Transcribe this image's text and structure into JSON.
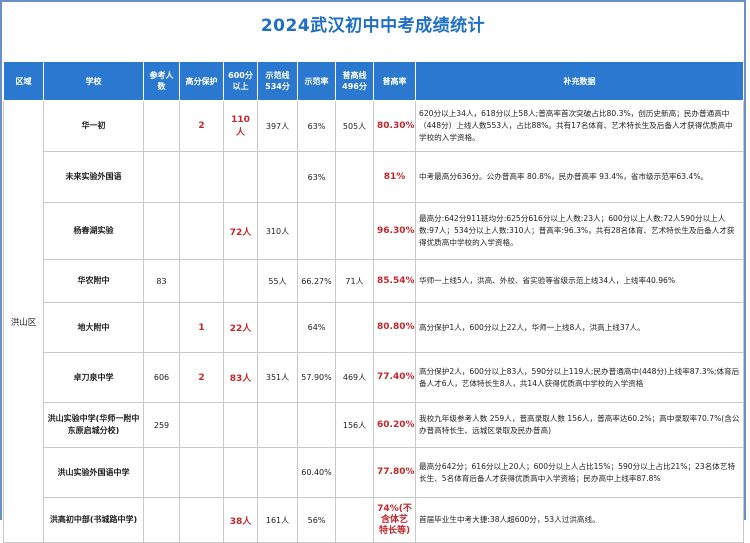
{
  "title": "2024武汉初中中考成绩统计",
  "columns": [
    "区域",
    "学校",
    "参考人数",
    "高分保护",
    "600分以上",
    "示范线534分",
    "示范率",
    "普高线496分",
    "普高率",
    "补充数据"
  ],
  "district": "洪山区",
  "rows": [
    {
      "school": "华一初",
      "ref": "",
      "hp": "2",
      "s600": "110人",
      "s534": "397人",
      "demo_rate": "63%",
      "s496": "505人",
      "rate": "80.30%",
      "note": "620分以上34人，618分以上58人;普高率首次突破占比80.3%，创历史新高；民办普通高中（448分）上线人数553人，占比88%。共有17名体育、艺术特长生及后备人才获得优质高中学校的入学资格。"
    },
    {
      "school": "未来实验外国语",
      "ref": "",
      "hp": "",
      "s600": "",
      "s534": "",
      "demo_rate": "63%",
      "s496": "",
      "rate": "81%",
      "note": "中考最高分636分。公办普高率 80.8%，民办普高率 93.4%，省市级示范率63.4%。"
    },
    {
      "school": "杨春湖实验",
      "ref": "",
      "hp": "",
      "s600": "72人",
      "s534": "310人",
      "demo_rate": "",
      "s496": "",
      "rate": "96.30%",
      "note": "最高分:642分911班均分:625分616分以上人数:23人；600分以上人数:72人590分以上人数:97人；534分以上人数:310人；普高率:96.3%，共有28名体育、艺术特长生及后备人才获得优质高中学校的入学资格。"
    },
    {
      "school": "华农附中",
      "ref": "83",
      "hp": "",
      "s600": "",
      "s534": "55人",
      "demo_rate": "66.27%",
      "s496": "71人",
      "rate": "85.54%",
      "note": "华师一上线5人，洪高、外校、省实验等省级示范上线34人，上线率40.96%"
    },
    {
      "school": "地大附中",
      "ref": "",
      "hp": "1",
      "s600": "22人",
      "s534": "",
      "demo_rate": "64%",
      "s496": "",
      "rate": "80.80%",
      "note": "高分保护1人，600分以上22人，华师一上线8人，洪高上线37人。"
    },
    {
      "school": "卓刀泉中学",
      "ref": "606",
      "hp": "2",
      "s600": "83人",
      "s534": "351人",
      "demo_rate": "57.90%",
      "s496": "469人",
      "rate": "77.40%",
      "note": "高分保护2人，600分以上83人，590分以上119人;民办普通高中(448分)上线率87.3%;体育后备人才6人，艺体特长生8人，共14人获得优质高中学校的入学资格"
    },
    {
      "school": "洪山实验中学(华师一附中东原启城分校)",
      "ref": "259",
      "hp": "",
      "s600": "",
      "s534": "",
      "demo_rate": "",
      "s496": "156人",
      "rate": "60.20%",
      "note": "我校九年级参考人数 259人，普高录取人数 156人，普高率达60.2%；高中录取率70.7%(含公办普高特长生、远城区录取及民办普高)"
    },
    {
      "school": "洪山实验外国语中学",
      "ref": "",
      "hp": "",
      "s600": "",
      "s534": "",
      "demo_rate": "60.40%",
      "s496": "",
      "rate": "77.80%",
      "note": "最高分642分；616分以上20人；600分以上人占比15%；590分以上占比21%；23名体艺特长生、5名体育后备人才获得优质高中入学资格；民办高中上线率87.8%"
    },
    {
      "school": "洪高初中部(书城路中学)",
      "ref": "",
      "hp": "",
      "s600": "38人",
      "s534": "161人",
      "demo_rate": "56%",
      "s496": "",
      "rate": "74%(不含体艺特长等)",
      "note": "首届毕业生中考大捷:38人超600分，53人过洪高线。"
    }
  ]
}
